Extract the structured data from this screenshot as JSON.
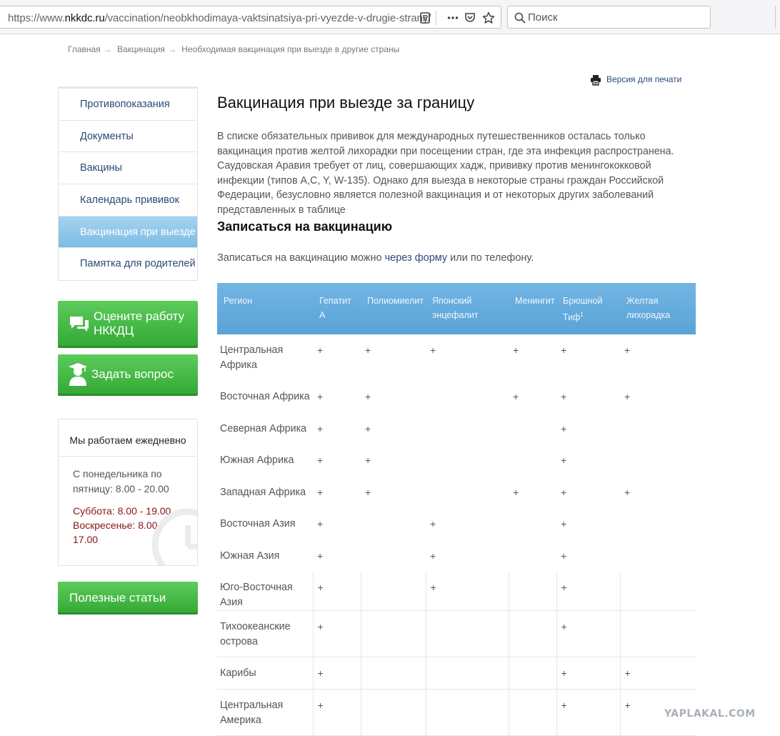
{
  "browser": {
    "url_prefix": "https://www.",
    "url_domain": "nkkdc.ru",
    "url_path": "/vaccination/neobkhodimaya-vaktsinatsiya-pri-vyezde-v-drugie-strany/",
    "search_placeholder": "Поиск"
  },
  "breadcrumb": [
    "Главная",
    "Вакцинация",
    "Необходимая вакцинация при выезде в другие страны"
  ],
  "print_label": "Версия для печати",
  "sidebar": {
    "menu": [
      {
        "label": "Противопоказания",
        "active": false
      },
      {
        "label": "Документы",
        "active": false
      },
      {
        "label": "Вакцины",
        "active": false
      },
      {
        "label": "Календарь прививок",
        "active": false
      },
      {
        "label": "Вакцинация при выезде",
        "active": true
      },
      {
        "label": "Памятка для родителей",
        "active": false
      }
    ],
    "rate_label": "Оцените работу НККДЦ",
    "ask_label": "Задать вопрос",
    "hours": {
      "title": "Мы работаем ежедневно",
      "weekdays": "С понедельника по пятницу: 8.00 - 20.00",
      "saturday": "Суббота: 8.00 - 19.00",
      "sunday": "Воскресенье: 8.00 - 17.00"
    },
    "useful_label": "Полезные статьи"
  },
  "main": {
    "title": "Вакцинация при выезде за границу",
    "intro": "В списке обязательных прививок для международных путешественников осталась только вакцинация против желтой лихорадки при посещении стран, где эта инфекция распространена. Саудовская Аравия требует от лиц, совершающих хадж, прививку против менингококковой инфекции (типов A,C, Y, W-135). Однако для выезда в некоторые страны граждан Российской Федерации, безусловно является полезной вакцинация и от некоторых других заболеваний представленных в таблице",
    "signup_heading": "Записаться на вакцинацию",
    "signup_text_before": "Записаться на вакцинацию можно ",
    "signup_link": "через форму",
    "signup_text_after": " или по телефону."
  },
  "table": {
    "headers": [
      "Регион",
      "Гепатит А",
      "Полиомиелит",
      "Японский энцефалит",
      "Менингит",
      "Брюшной Тиф",
      "Желтая лихорадка"
    ],
    "header_sup": "1",
    "rows": [
      {
        "region": "Центральная Африка",
        "marks": [
          "+",
          "+",
          "+",
          "+",
          "+",
          "+"
        ]
      },
      {
        "region": "Восточная Африка",
        "marks": [
          "+",
          "+",
          "",
          "+",
          "+",
          "+"
        ]
      },
      {
        "region": "Северная Африка",
        "marks": [
          "+",
          "+",
          "",
          "",
          "+",
          ""
        ]
      },
      {
        "region": "Южная Африка",
        "marks": [
          "+",
          "+",
          "",
          "",
          "+",
          ""
        ]
      },
      {
        "region": "Западная Африка",
        "marks": [
          "+",
          "+",
          "",
          "+",
          "+",
          "+"
        ]
      },
      {
        "region": "Восточная Азия",
        "marks": [
          "+",
          "",
          "+",
          "",
          "+",
          ""
        ]
      },
      {
        "region": "Южная Азия",
        "marks": [
          "+",
          "",
          "+",
          "",
          "+",
          ""
        ]
      },
      {
        "region": "Юго-Восточная Азия",
        "marks": [
          "+",
          "",
          "+",
          "",
          "+",
          ""
        ]
      },
      {
        "region": "Тихоокеанские острова",
        "marks": [
          "+",
          "",
          "",
          "",
          "+",
          ""
        ]
      },
      {
        "region": "Карибы",
        "marks": [
          "+",
          "",
          "",
          "",
          "+",
          "+"
        ]
      },
      {
        "region": "Центральная Америка",
        "marks": [
          "+",
          "",
          "",
          "",
          "+",
          "+"
        ]
      }
    ]
  },
  "watermark": "YAPLAKAL.COM",
  "colors": {
    "link": "#2a4a78",
    "table_header": "#5aa3d8",
    "green_button": "#3cb43c",
    "weekend_text": "#8a1414",
    "active_menu": "#7cbce4"
  }
}
